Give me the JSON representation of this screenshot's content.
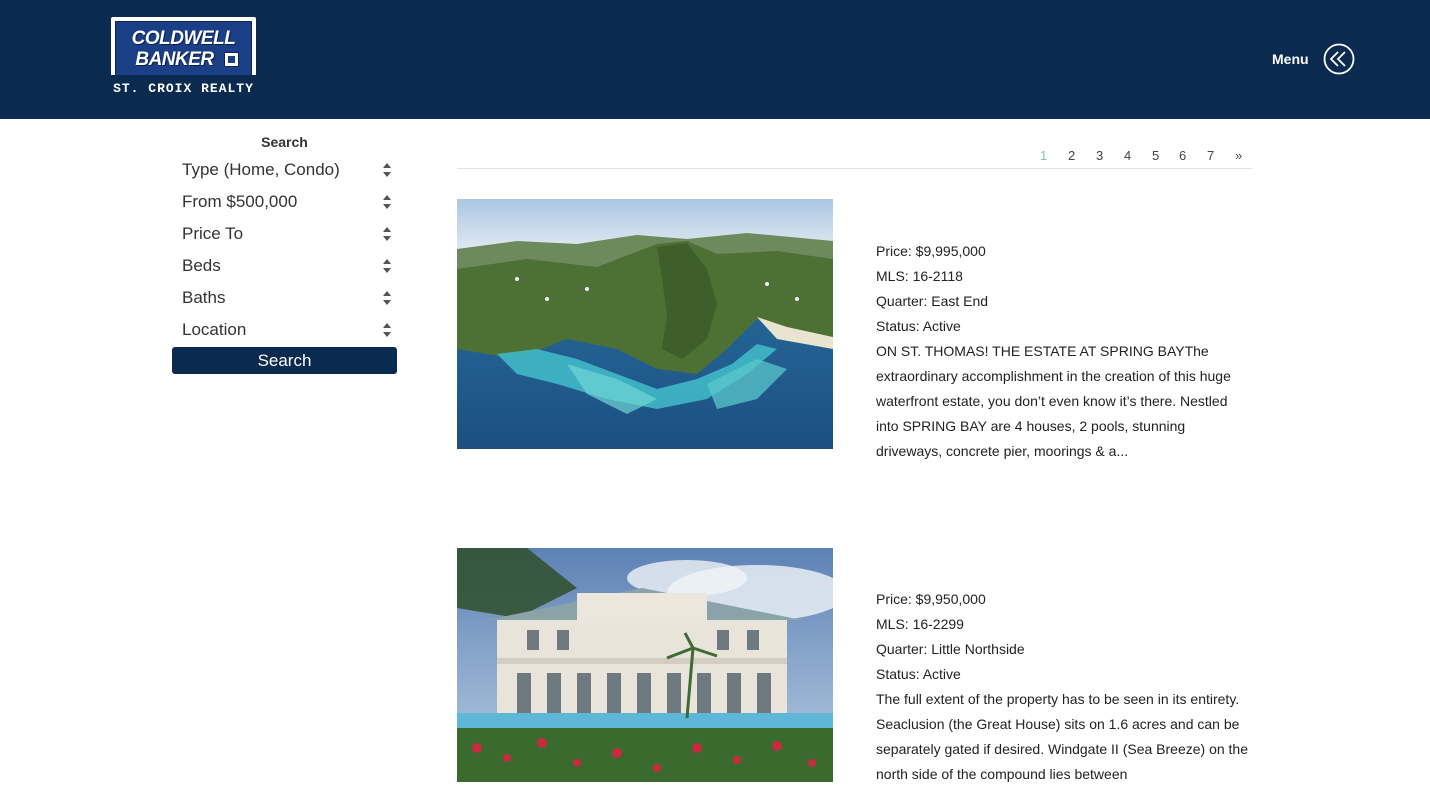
{
  "header": {
    "logo": {
      "line1": "COLDWELL",
      "line2": "BANKER",
      "line3": "ST. CROIX REALTY"
    },
    "menu_label": "Menu",
    "menu_icon": "double-chevron-left-icon",
    "colors": {
      "bar": "#0b2a4f",
      "accent": "#7fc4c0"
    }
  },
  "sidebar": {
    "title": "Search",
    "filters": [
      {
        "label": "Type (Home, Condo)"
      },
      {
        "label": "From $500,000"
      },
      {
        "label": "Price To"
      },
      {
        "label": "Beds"
      },
      {
        "label": "Baths"
      },
      {
        "label": "Location"
      }
    ],
    "search_button": "Search"
  },
  "pagination": {
    "pages": [
      "1",
      "2",
      "3",
      "4",
      "5",
      "6",
      "7"
    ],
    "next": "»",
    "current": "1"
  },
  "listings": [
    {
      "price": "Price: $9,995,000",
      "mls": "MLS: 16-2118",
      "quarter": "Quarter: East End",
      "status": "Status: Active",
      "description": "ON ST. THOMAS! THE ESTATE AT SPRING BAYThe extraordinary accomplishment in the creation of this huge waterfront estate, you don’t even know it’s there. Nestled into SPRING BAY are 4 houses, 2 pools, stunning driveways, concrete pier, moorings & a..."
    },
    {
      "price": "Price: $9,950,000",
      "mls": "MLS: 16-2299",
      "quarter": "Quarter: Little Northside",
      "status": "Status: Active",
      "description": "The full extent of the property has to be seen in its entirety. Seaclusion (the Great House) sits on 1.6 acres and can be separately gated if desired. Windgate II (Sea Breeze) on the north side of the compound lies between"
    }
  ]
}
